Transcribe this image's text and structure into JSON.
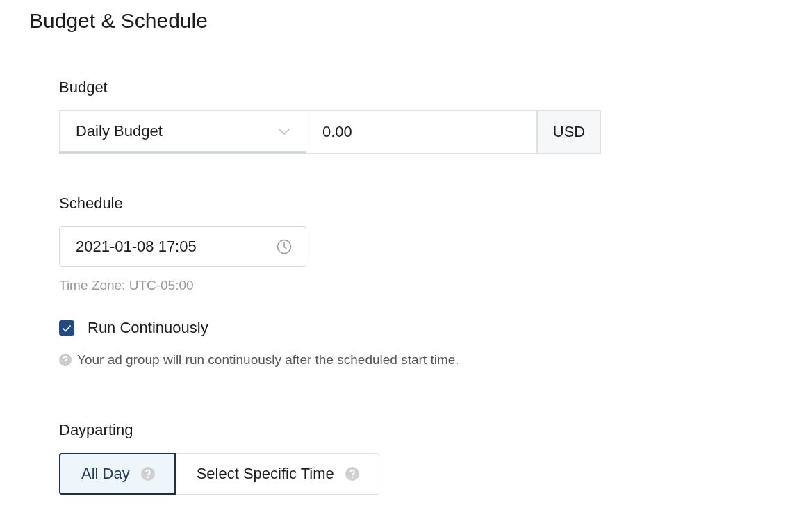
{
  "title": "Budget & Schedule",
  "budget": {
    "label": "Budget",
    "type": "Daily Budget",
    "amount": "0.00",
    "currency": "USD"
  },
  "schedule": {
    "label": "Schedule",
    "start": "2021-01-08 17:05",
    "time_zone": "Time Zone: UTC-05:00",
    "run_continuously": {
      "label": "Run Continuously",
      "checked": true
    },
    "hint": "Your ad group will run continuously after the scheduled start time."
  },
  "dayparting": {
    "label": "Dayparting",
    "options": [
      {
        "label": "All Day",
        "selected": true
      },
      {
        "label": "Select Specific Time",
        "selected": false
      }
    ]
  }
}
